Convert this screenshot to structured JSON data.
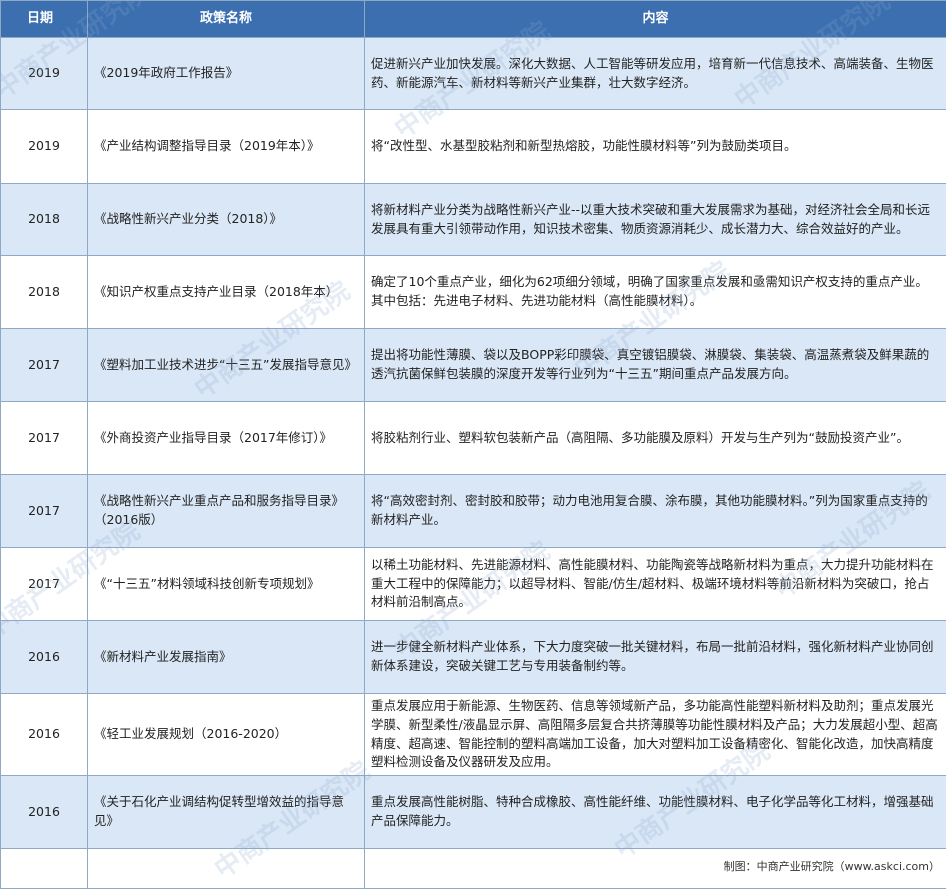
{
  "table": {
    "headers": {
      "date": "日期",
      "name": "政策名称",
      "content": "内容"
    },
    "rows": [
      {
        "date": "2019",
        "name": "《2019年政府工作报告》",
        "content": "促进新兴产业加快发展。深化大数据、人工智能等研发应用，培育新一代信息技术、高端装备、生物医药、新能源汽车、新材料等新兴产业集群，壮大数字经济。"
      },
      {
        "date": "2019",
        "name": "《产业结构调整指导目录（2019年本）》",
        "content": "将“改性型、水基型胶粘剂和新型热熔胶，功能性膜材料等”列为鼓励类项目。"
      },
      {
        "date": "2018",
        "name": "《战略性新兴产业分类（2018）》",
        "content": "将新材料产业分类为战略性新兴产业--以重大技术突破和重大发展需求为基础，对经济社会全局和长远发展具有重大引领带动作用，知识技术密集、物质资源消耗少、成长潜力大、综合效益好的产业。"
      },
      {
        "date": "2018",
        "name": "《知识产权重点支持产业目录（2018年本）",
        "content": "确定了10个重点产业，细化为62项细分领域，明确了国家重点发展和亟需知识产权支持的重点产业。其中包括：先进电子材料、先进功能材料（高性能膜材料）。"
      },
      {
        "date": "2017",
        "name": "《塑料加工业技术进步“十三五”发展指导意见》",
        "content": "提出将功能性薄膜、袋以及BOPP彩印膜袋、真空镀铝膜袋、淋膜袋、集装袋、高温蒸煮袋及鲜果蔬的透汽抗菌保鲜包装膜的深度开发等行业列为“十三五”期间重点产品发展方向。"
      },
      {
        "date": "2017",
        "name": "《外商投资产业指导目录（2017年修订）》",
        "content": "将胶粘剂行业、塑料软包装新产品（高阻隔、多功能膜及原料）开发与生产列为“鼓励投资产业”。"
      },
      {
        "date": "2017",
        "name": "《战略性新兴产业重点产品和服务指导目录》（2016版）",
        "content": "将“高效密封剂、密封胶和胶带；动力电池用复合膜、涂布膜，其他功能膜材料。”列为国家重点支持的新材料产业。"
      },
      {
        "date": "2017",
        "name": "《“十三五”材料领域科技创新专项规划》",
        "content": "以稀土功能材料、先进能源材料、高性能膜材料、功能陶瓷等战略新材料为重点，大力提升功能材料在重大工程中的保障能力；以超导材料、智能/仿生/超材料、极端环境材料等前沿新材料为突破口，抢占材料前沿制高点。"
      },
      {
        "date": "2016",
        "name": "《新材料产业发展指南》",
        "content": "进一步健全新材料产业体系，下大力度突破一批关键材料，布局一批前沿材料，强化新材料产业协同创新体系建设，突破关键工艺与专用装备制约等。"
      },
      {
        "date": "2016",
        "name": "《轻工业发展规划（2016-2020）",
        "content": "重点发展应用于新能源、生物医药、信息等领域新产品，多功能高性能塑料新材料及助剂；重点发展光学膜、新型柔性/液晶显示屏、高阻隔多层复合共挤薄膜等功能性膜材料及产品；大力发展超小型、超高精度、超高速、智能控制的塑料高端加工设备，加大对塑料加工设备精密化、智能化改造，加快高精度塑料检测设备及仪器研发及应用。"
      },
      {
        "date": "2016",
        "name": "《关于石化产业调结构促转型增效益的指导意见》",
        "content": "重点发展高性能树脂、特种合成橡胶、高性能纤维、功能性膜材料、电子化学品等化工材料，增强基础产品保障能力。"
      }
    ],
    "source": "制图：中商产业研究院（www.askci.com）"
  },
  "watermark": "中商产业研究院",
  "colors": {
    "header_bg": "#3b6fb0",
    "stripe_bg": "#dae7f6",
    "border": "#8fa8c4"
  }
}
